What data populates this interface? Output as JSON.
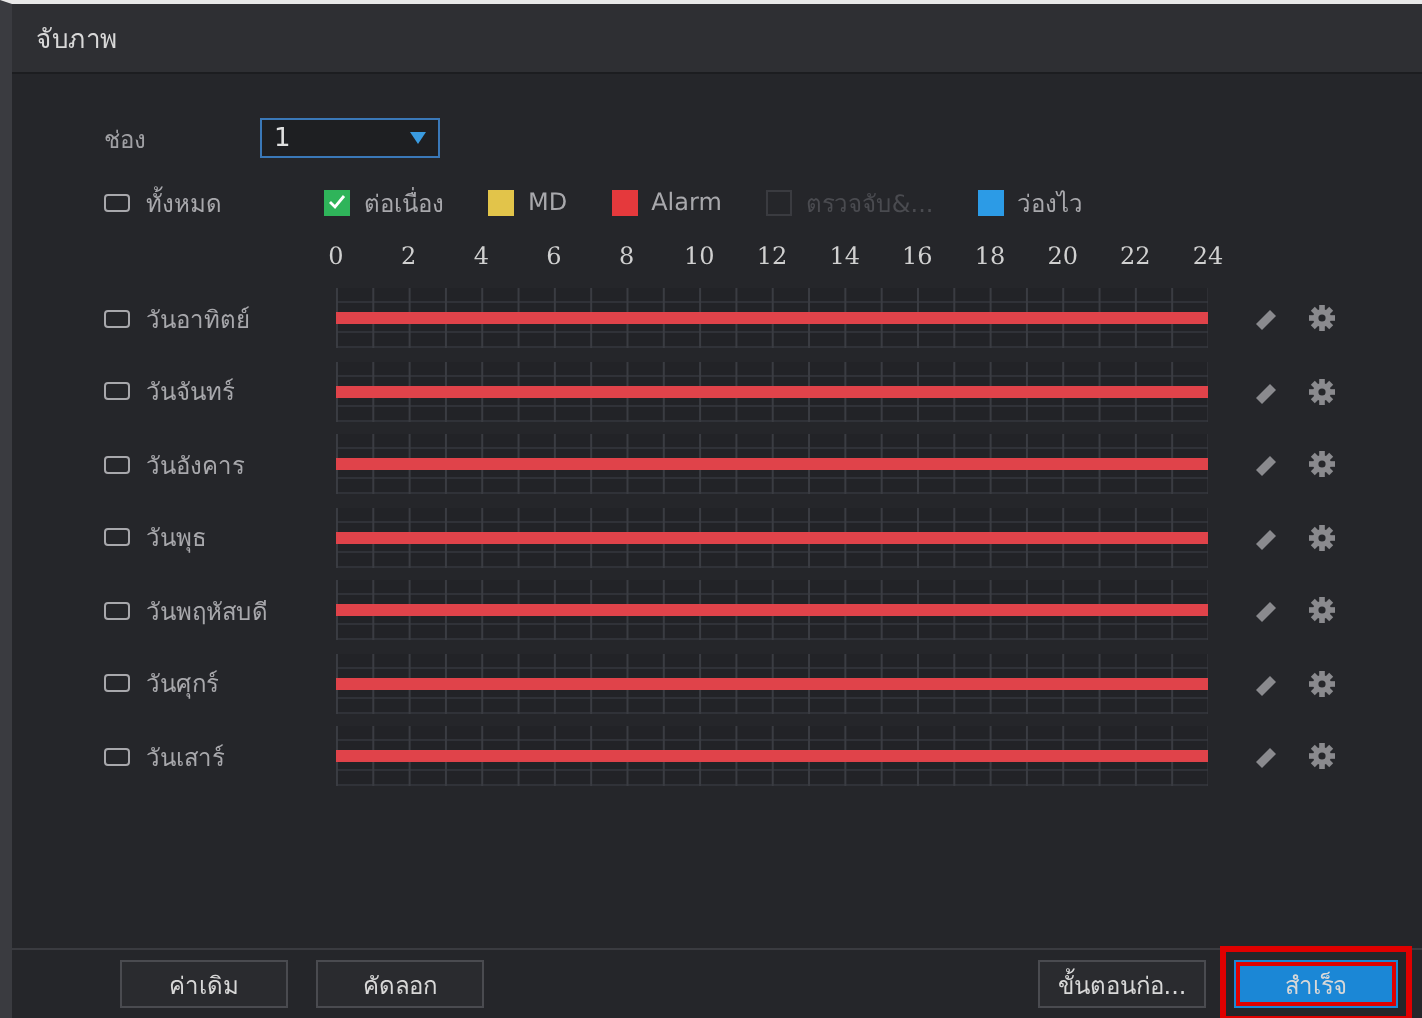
{
  "window": {
    "title": "จับภาพ"
  },
  "channel": {
    "label": "ช่อง",
    "value": "1"
  },
  "select_all": {
    "label": "ทั้งหมด",
    "checked": false
  },
  "legend": [
    {
      "label": "ต่อเนื่อง",
      "color": "#2fb45a",
      "checked": true,
      "disabled": false
    },
    {
      "label": "MD",
      "color": "#e2c44a",
      "checked": false,
      "disabled": false
    },
    {
      "label": "Alarm",
      "color": "#e5393c",
      "checked": false,
      "disabled": false
    },
    {
      "label": "ตรวจจับ&...",
      "color": "#25262a",
      "checked": false,
      "disabled": true
    },
    {
      "label": "ว่องไว",
      "color": "#2c9be6",
      "checked": false,
      "disabled": false
    }
  ],
  "hours": [
    "0",
    "2",
    "4",
    "6",
    "8",
    "10",
    "12",
    "14",
    "16",
    "18",
    "20",
    "22",
    "24"
  ],
  "days": [
    {
      "label": "วันอาทิตย์",
      "checked": false,
      "level": 1
    },
    {
      "label": "วันจันทร์",
      "checked": false,
      "level": 1
    },
    {
      "label": "วันอังคาร",
      "checked": false,
      "level": 1
    },
    {
      "label": "วันพุธ",
      "checked": false,
      "level": 1
    },
    {
      "label": "วันพฤหัสบดี",
      "checked": false,
      "level": 1
    },
    {
      "label": "วันศุกร์",
      "checked": false,
      "level": 1
    },
    {
      "label": "วันเสาร์",
      "checked": false,
      "level": 1
    }
  ],
  "buttons_left": [
    "ค่าเดิม",
    "คัดลอก"
  ],
  "buttons_right": [
    {
      "label": "ขั้นตอนก่อ...",
      "kind": "secondary",
      "highlighted": false
    },
    {
      "label": "สำเร็จ",
      "kind": "primary",
      "highlighted": true
    }
  ]
}
